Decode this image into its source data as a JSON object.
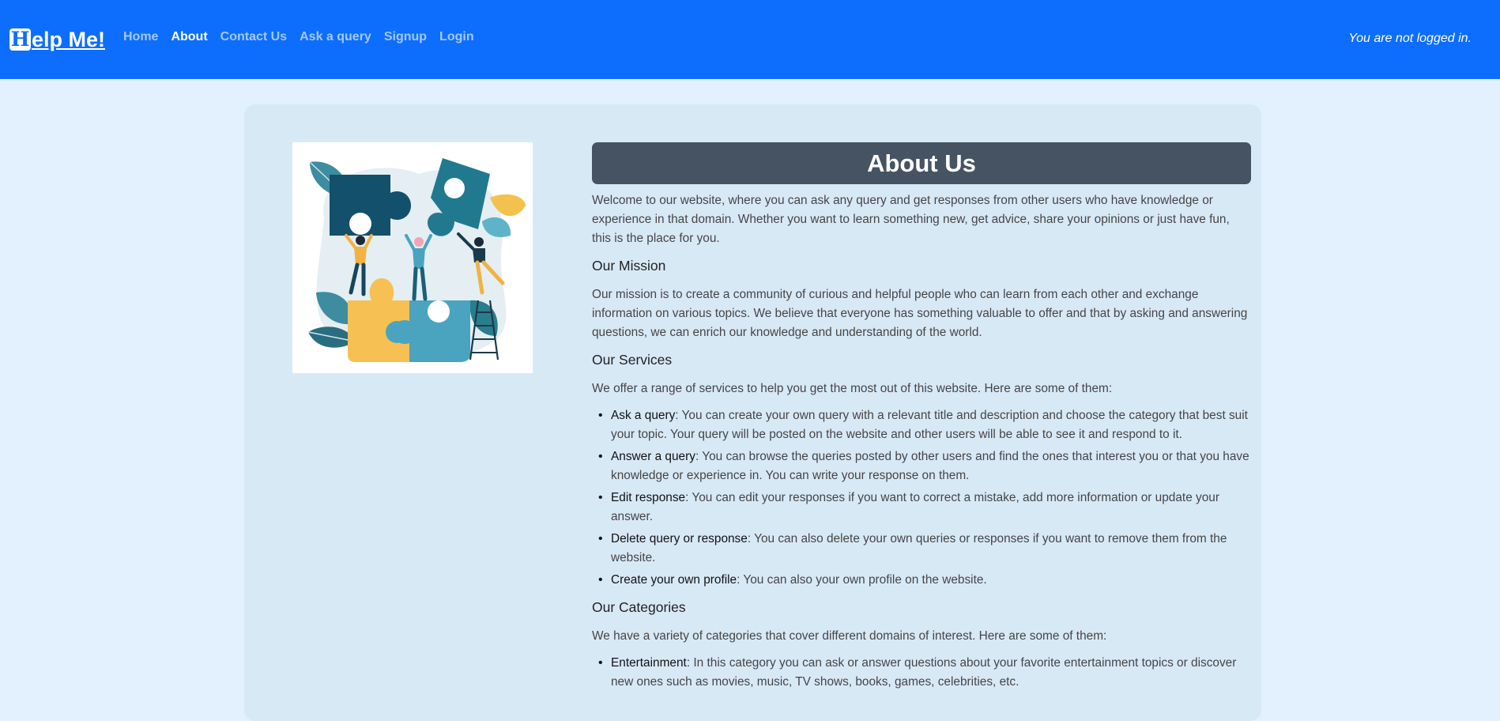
{
  "nav": {
    "brand_initial": "H",
    "brand_rest": "elp Me!",
    "links": [
      "Home",
      "About",
      "Contact Us",
      "Ask a query",
      "Signup",
      "Login"
    ],
    "active_link": "About",
    "status": "You are not logged in."
  },
  "about": {
    "title": "About Us",
    "intro": "Welcome to our website, where you can ask any query and get responses from other users who have knowledge or experience in that domain. Whether you want to learn something new, get advice, share your opinions or just have fun, this is the place for you.",
    "mission_heading": "Our Mission",
    "mission_text": "Our mission is to create a community of curious and helpful people who can learn from each other and exchange information on various topics. We believe that everyone has something valuable to offer and that by asking and answering questions, we can enrich our knowledge and understanding of the world.",
    "services_heading": "Our Services",
    "services_intro": "We offer a range of services to help you get the most out of this website. Here are some of them:",
    "services": [
      {
        "term": "Ask a query",
        "desc": ": You can create your own query with a relevant title and description and choose the category that best suit your topic. Your query will be posted on the website and other users will be able to see it and respond to it."
      },
      {
        "term": "Answer a query",
        "desc": ": You can browse the queries posted by other users and find the ones that interest you or that you have knowledge or experience in. You can write your response on them."
      },
      {
        "term": "Edit response",
        "desc": ": You can edit your responses if you want to correct a mistake, add more information or update your answer."
      },
      {
        "term": "Delete query or response",
        "desc": ": You can also delete your own queries or responses if you want to remove them from the website."
      },
      {
        "term": "Create your own profile",
        "desc": ": You can also your own profile on the website."
      }
    ],
    "categories_heading": "Our Categories",
    "categories_intro": "We have a variety of categories that cover different domains of interest. Here are some of them:",
    "categories": [
      {
        "term": "Entertainment",
        "desc": ": In this category you can ask or answer questions about your favorite entertainment topics or discover new ones such as movies, music, TV shows, books, games, celebrities, etc."
      }
    ]
  },
  "colors": {
    "navbar": "#0d6efd",
    "page_bg": "#e3f0fd",
    "card_bg": "#d8e9f6",
    "title_bar": "#465362"
  }
}
